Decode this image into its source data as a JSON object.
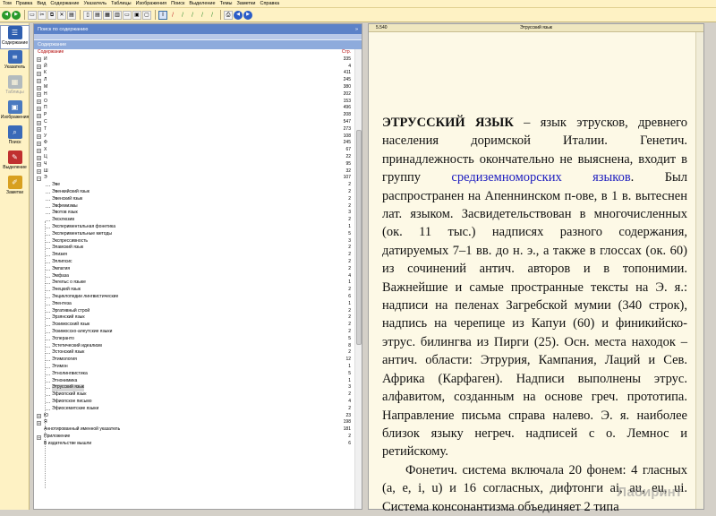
{
  "menu": [
    "Том",
    "Правка",
    "Вид",
    "Содержание",
    "Указатель",
    "Таблицы",
    "Изображения",
    "Поиск",
    "Выделение",
    "Темы",
    "Заметки",
    "Справка"
  ],
  "toolbar_icons": [
    {
      "name": "back-arrow-icon",
      "glyph": "◀",
      "style": "round green"
    },
    {
      "name": "forward-arrow-icon",
      "glyph": "▶",
      "style": "round green"
    },
    {
      "sep": true
    },
    {
      "name": "open-icon",
      "glyph": "▭",
      "style": ""
    },
    {
      "name": "cut-icon",
      "glyph": "✂",
      "style": ""
    },
    {
      "name": "copy-icon",
      "glyph": "⧉",
      "style": ""
    },
    {
      "name": "delete-icon",
      "glyph": "✕",
      "style": ""
    },
    {
      "name": "paste-icon",
      "glyph": "▤",
      "style": ""
    },
    {
      "sep": true
    },
    {
      "name": "page-view-1-icon",
      "glyph": "▯",
      "style": ""
    },
    {
      "name": "page-view-2-icon",
      "glyph": "▤",
      "style": ""
    },
    {
      "name": "page-view-3-icon",
      "glyph": "▦",
      "style": ""
    },
    {
      "name": "page-view-4-icon",
      "glyph": "▥",
      "style": ""
    },
    {
      "name": "page-view-5-icon",
      "glyph": "▭",
      "style": ""
    },
    {
      "name": "page-view-6-icon",
      "glyph": "▣",
      "style": ""
    },
    {
      "name": "page-view-7-icon",
      "glyph": "▢",
      "style": ""
    },
    {
      "sep": true
    },
    {
      "name": "text-cursor-icon",
      "glyph": "I",
      "style": "sel"
    },
    {
      "name": "marker-red-icon",
      "glyph": "/",
      "style": "flat",
      "color": "#c02020"
    },
    {
      "name": "marker-green-icon",
      "glyph": "/",
      "style": "flat",
      "color": "#2a8a2a"
    },
    {
      "name": "marker-green-2-icon",
      "glyph": "/",
      "style": "flat",
      "color": "#2a8a2a"
    },
    {
      "name": "marker-green-3-icon",
      "glyph": "/",
      "style": "flat",
      "color": "#2a8a2a"
    },
    {
      "name": "marker-green-4-icon",
      "glyph": "/",
      "style": "flat",
      "color": "#2a8a2a"
    },
    {
      "sep": true
    },
    {
      "name": "print-icon",
      "glyph": "⎙",
      "style": ""
    },
    {
      "name": "nav-back-icon",
      "glyph": "◀",
      "style": "round blue"
    },
    {
      "name": "nav-forward-icon",
      "glyph": "▶",
      "style": "round blue"
    }
  ],
  "sidebar": [
    {
      "label": "Содержание",
      "icon": "contents-icon",
      "glyph": "☰",
      "color": "#2f5fb0",
      "active": true,
      "disabled": false
    },
    {
      "label": "Указатель",
      "icon": "index-icon",
      "glyph": "≡",
      "color": "#3a6ab8",
      "active": false,
      "disabled": false
    },
    {
      "label": "Таблицы",
      "icon": "tables-icon",
      "glyph": "▦",
      "color": "#5a7ab8",
      "active": false,
      "disabled": true
    },
    {
      "label": "Изображения",
      "icon": "images-icon",
      "glyph": "▣",
      "color": "#4a7ac0",
      "active": false,
      "disabled": false
    },
    {
      "label": "Поиск",
      "icon": "search-icon",
      "glyph": "⌕",
      "color": "#3a6ab8",
      "active": false,
      "disabled": false
    },
    {
      "label": "Выделение",
      "icon": "highlight-icon",
      "glyph": "✎",
      "color": "#c03030",
      "active": false,
      "disabled": false
    },
    {
      "label": "Заметки",
      "icon": "notes-icon",
      "glyph": "✐",
      "color": "#d8a020",
      "active": false,
      "disabled": false
    }
  ],
  "left_panel": {
    "search_header": "Поиск по содержанию",
    "contents_header": "Содержание",
    "col_title": "Содержание",
    "col_page": "Стр."
  },
  "tree": [
    {
      "t": "И",
      "p": "335",
      "lvl": 0
    },
    {
      "t": "Й",
      "p": "4",
      "lvl": 0
    },
    {
      "t": "К",
      "p": "411",
      "lvl": 0
    },
    {
      "t": "Л",
      "p": "245",
      "lvl": 0
    },
    {
      "t": "М",
      "p": "380",
      "lvl": 0
    },
    {
      "t": "Н",
      "p": "202",
      "lvl": 0
    },
    {
      "t": "О",
      "p": "153",
      "lvl": 0
    },
    {
      "t": "П",
      "p": "496",
      "lvl": 0
    },
    {
      "t": "Р",
      "p": "208",
      "lvl": 0
    },
    {
      "t": "С",
      "p": "547",
      "lvl": 0
    },
    {
      "t": "Т",
      "p": "273",
      "lvl": 0
    },
    {
      "t": "У",
      "p": "108",
      "lvl": 0
    },
    {
      "t": "Ф",
      "p": "245",
      "lvl": 0
    },
    {
      "t": "Х",
      "p": "67",
      "lvl": 0
    },
    {
      "t": "Ц",
      "p": "22",
      "lvl": 0
    },
    {
      "t": "Ч",
      "p": "95",
      "lvl": 0
    },
    {
      "t": "Ш",
      "p": "32",
      "lvl": 0
    },
    {
      "t": "Э",
      "p": "107",
      "lvl": 0,
      "open": true
    },
    {
      "t": "Эве",
      "p": "2",
      "lvl": 1
    },
    {
      "t": "Эвенкийский язык",
      "p": "2",
      "lvl": 1
    },
    {
      "t": "Эвенский язык",
      "p": "2",
      "lvl": 1
    },
    {
      "t": "Эвфемизмы",
      "p": "2",
      "lvl": 1
    },
    {
      "t": "Эвотов язык",
      "p": "3",
      "lvl": 1
    },
    {
      "t": "Эксклюзив",
      "p": "2",
      "lvl": 1
    },
    {
      "t": "Экспериментальная фонетика",
      "p": "1",
      "lvl": 1
    },
    {
      "t": "Экспериментальные методы",
      "p": "5",
      "lvl": 1
    },
    {
      "t": "Экспрессивность",
      "p": "3",
      "lvl": 1
    },
    {
      "t": "Эламский язык",
      "p": "2",
      "lvl": 1
    },
    {
      "t": "Элизия",
      "p": "2",
      "lvl": 1
    },
    {
      "t": "Эллипсис",
      "p": "2",
      "lvl": 1
    },
    {
      "t": "Эмпатия",
      "p": "2",
      "lvl": 1
    },
    {
      "t": "Эмфаза",
      "p": "4",
      "lvl": 1
    },
    {
      "t": "Энгельс о языке",
      "p": "1",
      "lvl": 1
    },
    {
      "t": "Энецкий язык",
      "p": "2",
      "lvl": 1
    },
    {
      "t": "Энциклопедии лингвистические",
      "p": "6",
      "lvl": 1
    },
    {
      "t": "Эпентеза",
      "p": "1",
      "lvl": 1
    },
    {
      "t": "Эргативный строй",
      "p": "2",
      "lvl": 1
    },
    {
      "t": "Эрзянский язык",
      "p": "2",
      "lvl": 1
    },
    {
      "t": "Эскимосский язык",
      "p": "2",
      "lvl": 1
    },
    {
      "t": "Эскимосско-алеутские языки",
      "p": "2",
      "lvl": 1
    },
    {
      "t": "Эсперанто",
      "p": "5",
      "lvl": 1
    },
    {
      "t": "Эстетический идеализм",
      "p": "8",
      "lvl": 1
    },
    {
      "t": "Эстонский язык",
      "p": "2",
      "lvl": 1
    },
    {
      "t": "Этимология",
      "p": "12",
      "lvl": 1
    },
    {
      "t": "Этимон",
      "p": "1",
      "lvl": 1
    },
    {
      "t": "Этнолингвистика",
      "p": "5",
      "lvl": 1
    },
    {
      "t": "Этнонимика",
      "p": "1",
      "lvl": 1
    },
    {
      "t": "Этрусский язык",
      "p": "3",
      "lvl": 1,
      "sel": true
    },
    {
      "t": "Эфиопский язык",
      "p": "2",
      "lvl": 1
    },
    {
      "t": "Эфиопское письмо",
      "p": "4",
      "lvl": 1
    },
    {
      "t": "Эфиосемитские языки",
      "p": "2",
      "lvl": 1
    },
    {
      "t": "Ю",
      "p": "23",
      "lvl": 0
    },
    {
      "t": "Я",
      "p": "198",
      "lvl": 0
    },
    {
      "t": "Аннотированный именной указатель",
      "p": "181",
      "lvl": 0,
      "noexp": true
    },
    {
      "t": "Приложение",
      "p": "2",
      "lvl": 0
    },
    {
      "t": "В издательстве вышли",
      "p": "6",
      "lvl": 0,
      "noexp": true
    }
  ],
  "right_panel": {
    "page_num": "5.540",
    "page_title": "Этрусский язык",
    "heading": "ЭТРУССКИЙ ЯЗЫК",
    "text1": " – язык этрусков, древнего населения доримской Италии. Генетич. принадлежность окончательно не выяснена, входит в группу ",
    "link": "средиземноморских языков",
    "text2": ". Был распространен на Апеннинском п-ове, в 1 в. вытеснен лат. языком. Засвидетельствован в многочисленных (ок. 11 тыс.) надписях разного содержания, датируемых 7–1 вв. до н. э., а также в глоссах (ок. 60) из сочинений антич. авторов и в топонимии. Важнейшие и самые пространные тексты на Э. я.: надписи на пеленах Загребской мумии (340 строк), надпись на черепице из Капуи (60) и финикийско-этрус. билингва из Пирги (25). Осн. места находок – антич. области: Этрурия, Кампания, Лаций и Сев. Африка (Карфаген). Надписи выполнены этрус. алфавитом, созданным на основе греч. прототипа. Направление письма справа налево. Э. я. наиболее близок языку негреч. надписей с о. Лемнос и ретийскому.",
    "text3": "Фонетич. система включала 20 фонем: 4 гласных (a, e, i, u) и 16 согласных, дифтонги ai, au, eu, ui. Система консонантизма объединяет 2 типа",
    "watermark": "Лабиринт"
  }
}
